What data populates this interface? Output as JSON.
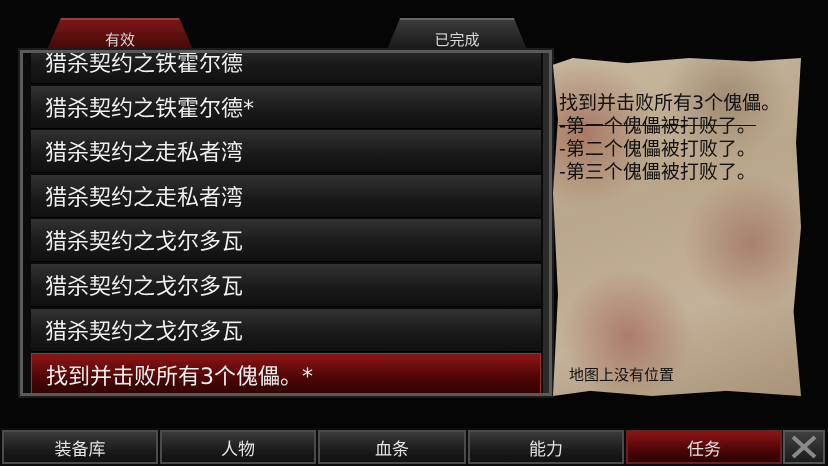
{
  "tabs": {
    "active": "有效",
    "completed": "已完成"
  },
  "quests": [
    "猎杀契约之铁霍尔德",
    "猎杀契约之铁霍尔德*",
    "猎杀契约之走私者湾",
    "猎杀契约之走私者湾",
    "猎杀契约之戈尔多瓦",
    "猎杀契约之戈尔多瓦",
    "猎杀契约之戈尔多瓦",
    "找到并击败所有3个傀儡。*"
  ],
  "detail": {
    "objective": "找到并击败所有3个傀儡。",
    "steps": [
      {
        "text": "-第一个傀儡被打败了。",
        "done": true
      },
      {
        "text": "-第二个傀儡被打败了。",
        "done": false
      },
      {
        "text": "-第三个傀儡被打败了。",
        "done": false
      }
    ],
    "map_note": "地图上没有位置"
  },
  "bottom_nav": [
    "装备库",
    "人物",
    "血条",
    "能力",
    "任务"
  ],
  "colors": {
    "accent_red": "#8b1616",
    "parchment": "#c4b199"
  },
  "icons": {
    "close": "close-icon"
  }
}
